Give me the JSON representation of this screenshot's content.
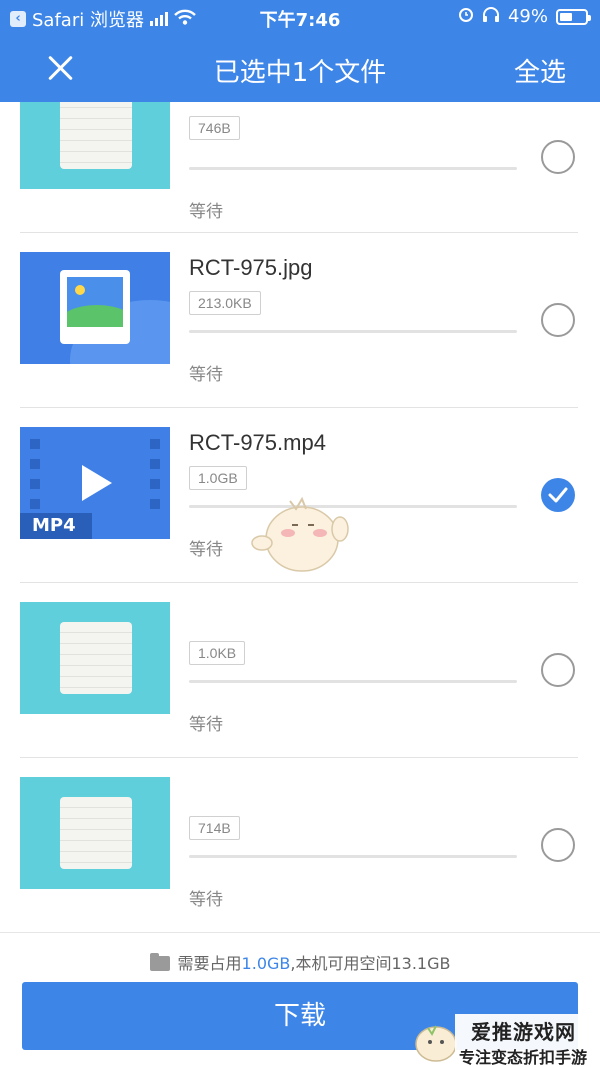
{
  "status_bar": {
    "back_app": "Safari 浏览器",
    "time": "下午7:46",
    "battery": "49%",
    "battery_level": 0.49
  },
  "header": {
    "title": "已选中1个文件",
    "select_all": "全选"
  },
  "files": [
    {
      "type": "txt",
      "name": "",
      "size": "746B",
      "status": "等待",
      "selected": false
    },
    {
      "type": "image",
      "name": "RCT-975.jpg",
      "size": "213.0KB",
      "status": "等待",
      "selected": false
    },
    {
      "type": "video",
      "name": "RCT-975.mp4",
      "size": "1.0GB",
      "status": "等待",
      "selected": true,
      "badge": "MP4"
    },
    {
      "type": "txt",
      "name": "",
      "size": "1.0KB",
      "status": "等待",
      "selected": false
    },
    {
      "type": "txt",
      "name": "",
      "size": "714B",
      "status": "等待",
      "selected": false
    }
  ],
  "footer": {
    "space_prefix": "需要占用",
    "space_needed": "1.0GB",
    "space_suffix": ",本机可用空间13.1GB",
    "download": "下载"
  },
  "watermark": {
    "line1": "爱推游戏网",
    "line2": "专注变态折扣手游"
  },
  "colors": {
    "primary": "#3d86e8",
    "txt_thumb": "#5fcfdc",
    "media_thumb": "#3f7fe6"
  }
}
